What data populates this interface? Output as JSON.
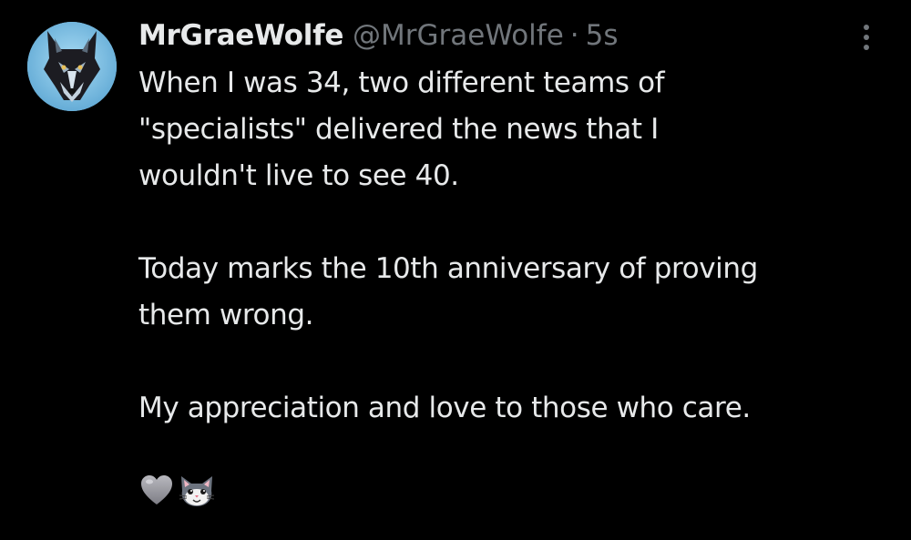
{
  "post": {
    "display_name": "MrGraeWolfe",
    "handle": "@MrGraeWolfe",
    "separator": "·",
    "timestamp": "5s",
    "text": {
      "paragraph_1": {
        "line_1": "When I was 34, two different teams of",
        "line_2": "\"specialists\" delivered the news that I",
        "line_3": "wouldn't live to see 40."
      },
      "paragraph_2": {
        "line_1": "Today marks the 10th anniversary of proving",
        "line_2": "them wrong."
      },
      "paragraph_3": {
        "line_1": "My appreciation and love to those who care."
      }
    },
    "emojis": [
      "grey-heart-icon",
      "cat-face-icon"
    ]
  },
  "avatar": {
    "icon": "wolf-avatar-icon",
    "background_color": "#7fc3e6"
  },
  "more_menu": {
    "icon": "more-vertical-icon"
  },
  "colors": {
    "background": "#000000",
    "primary_text": "#e7e9ea",
    "secondary_text": "#71767b"
  }
}
